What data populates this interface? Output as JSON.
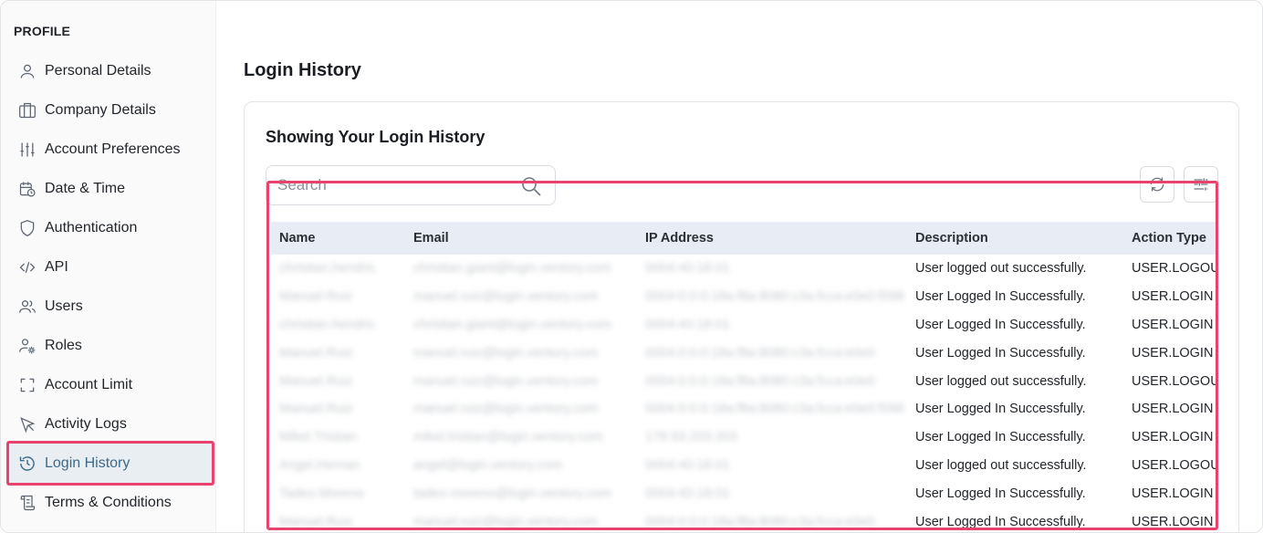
{
  "sidebar": {
    "heading": "PROFILE",
    "items": [
      {
        "label": "Personal Details",
        "icon": "user-icon"
      },
      {
        "label": "Company Details",
        "icon": "briefcase-icon"
      },
      {
        "label": "Account Preferences",
        "icon": "sliders-icon"
      },
      {
        "label": "Date & Time",
        "icon": "calendar-clock-icon"
      },
      {
        "label": "Authentication",
        "icon": "shield-icon"
      },
      {
        "label": "API",
        "icon": "code-icon"
      },
      {
        "label": "Users",
        "icon": "users-icon"
      },
      {
        "label": "Roles",
        "icon": "user-gear-icon"
      },
      {
        "label": "Account Limit",
        "icon": "frame-corners-icon"
      },
      {
        "label": "Activity Logs",
        "icon": "cursor-icon"
      },
      {
        "label": "Login History",
        "icon": "history-icon",
        "active": true
      },
      {
        "label": "Terms & Conditions",
        "icon": "scroll-icon"
      }
    ]
  },
  "main": {
    "title": "Login History",
    "card_title": "Showing Your Login History",
    "search_placeholder": "Search",
    "columns": [
      "Name",
      "Email",
      "IP Address",
      "Description",
      "Action Type"
    ],
    "rows": [
      [
        "christian.hendric",
        "christian.giant@login.ventory.com",
        "0004:40:18:01",
        "User logged out successfully.",
        "USER.LOGOUT"
      ],
      [
        "Manuel.Ruiz",
        "manuel.ruiz@login.ventory.com",
        "0004:0:0:0:18a:f8a:8080:c3a:fcca:e0e0:f098",
        "User Logged In Successfully.",
        "USER.LOGIN"
      ],
      [
        "christian.hendric",
        "christian.giant@login.ventory.com",
        "0004:40:18:01",
        "User Logged In Successfully.",
        "USER.LOGIN"
      ],
      [
        "Manuel.Ruiz",
        "manuel.ruiz@login.ventory.com",
        "0004:0:0:0:18a:f8a:8080:c3a:fcca:e0e0",
        "User Logged In Successfully.",
        "USER.LOGIN"
      ],
      [
        "Manuel.Ruiz",
        "manuel.ruiz@login.ventory.com",
        "0004:0:0:0:18a:f8a:8080:c3a:fcca:e0e0",
        "User logged out successfully.",
        "USER.LOGOUT"
      ],
      [
        "Manuel.Ruiz",
        "manuel.ruiz@login.ventory.com",
        "0004:0:0:0:18a:f8a:8080:c3a:fcca:e0e0:f098",
        "User Logged In Successfully.",
        "USER.LOGIN"
      ],
      [
        "Mikel.Tristian",
        "mikel.tristian@login.ventory.com",
        "178.93.203.203",
        "User Logged In Successfully.",
        "USER.LOGIN"
      ],
      [
        "Angel.Hernan",
        "angel@login.ventory.com",
        "0004:40:18:01",
        "User logged out successfully.",
        "USER.LOGOUT"
      ],
      [
        "Tadeo.Moreno",
        "tadeo.moreno@login.ventory.com",
        "0004:40:18:01",
        "User Logged In Successfully.",
        "USER.LOGIN"
      ],
      [
        "Manuel.Ruiz",
        "manuel.ruiz@login.ventory.com",
        "0004:0:0:0:18a:f8a:8080:c3a:fcca:e0e0",
        "User Logged In Successfully.",
        "USER.LOGIN"
      ]
    ]
  },
  "colors": {
    "accent": "#3d6a88",
    "highlight": "#e8436f",
    "header_bg": "#e8ecf5"
  }
}
